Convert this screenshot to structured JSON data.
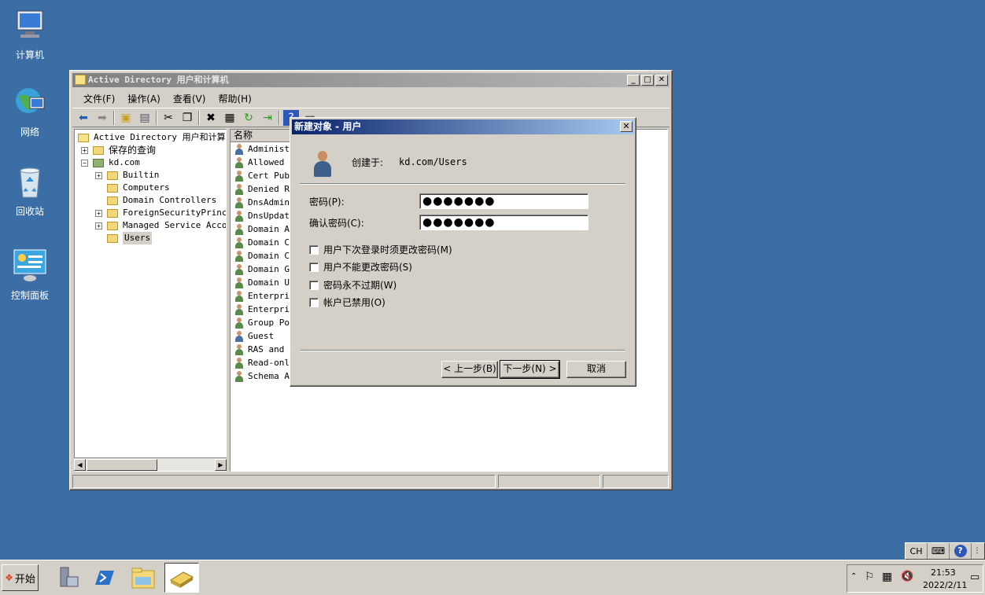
{
  "desktop": {
    "icons": [
      {
        "label": "计算机"
      },
      {
        "label": "网络"
      },
      {
        "label": "回收站"
      },
      {
        "label": "控制面板"
      }
    ]
  },
  "ad_window": {
    "title": "Active Directory 用户和计算机",
    "menu": [
      "文件(F)",
      "操作(A)",
      "查看(V)",
      "帮助(H)"
    ],
    "tree": {
      "root": "Active Directory 用户和计算机",
      "saved_queries": "保存的查询",
      "domain": "kd.com",
      "children": [
        "Builtin",
        "Computers",
        "Domain Controllers",
        "ForeignSecurityPrincip",
        "Managed Service Accour",
        "Users"
      ]
    },
    "list": {
      "column": "名称",
      "rows": [
        "Administ",
        "Allowed R",
        "Cert Publ",
        "Denied RO",
        "DnsAdmins",
        "DnsUpdate",
        "Domain Ad",
        "Domain Co",
        "Domain Co",
        "Domain Gu",
        "Domain Us",
        "Enterpris",
        "Enterpris",
        "Group Pol",
        "Guest",
        "RAS and I",
        "Read-only",
        "Schema Ad"
      ]
    }
  },
  "dialog": {
    "title": "新建对象 - 用户",
    "created_in_label": "创建于:",
    "created_in_value": "kd.com/Users",
    "password_label": "密码(P):",
    "password_value": "●●●●●●●",
    "confirm_label": "确认密码(C):",
    "confirm_value": "●●●●●●●",
    "checkboxes": [
      {
        "label": "用户下次登录时须更改密码(M)"
      },
      {
        "label": "用户不能更改密码(S)"
      },
      {
        "label": "密码永不过期(W)"
      },
      {
        "label": "帐户已禁用(O)"
      }
    ],
    "buttons": {
      "back": "< 上一步(B)",
      "next": "下一步(N) >",
      "cancel": "取消"
    }
  },
  "taskbar": {
    "start": "开始",
    "lang": "CH",
    "time": "21:53",
    "date": "2022/2/11"
  }
}
